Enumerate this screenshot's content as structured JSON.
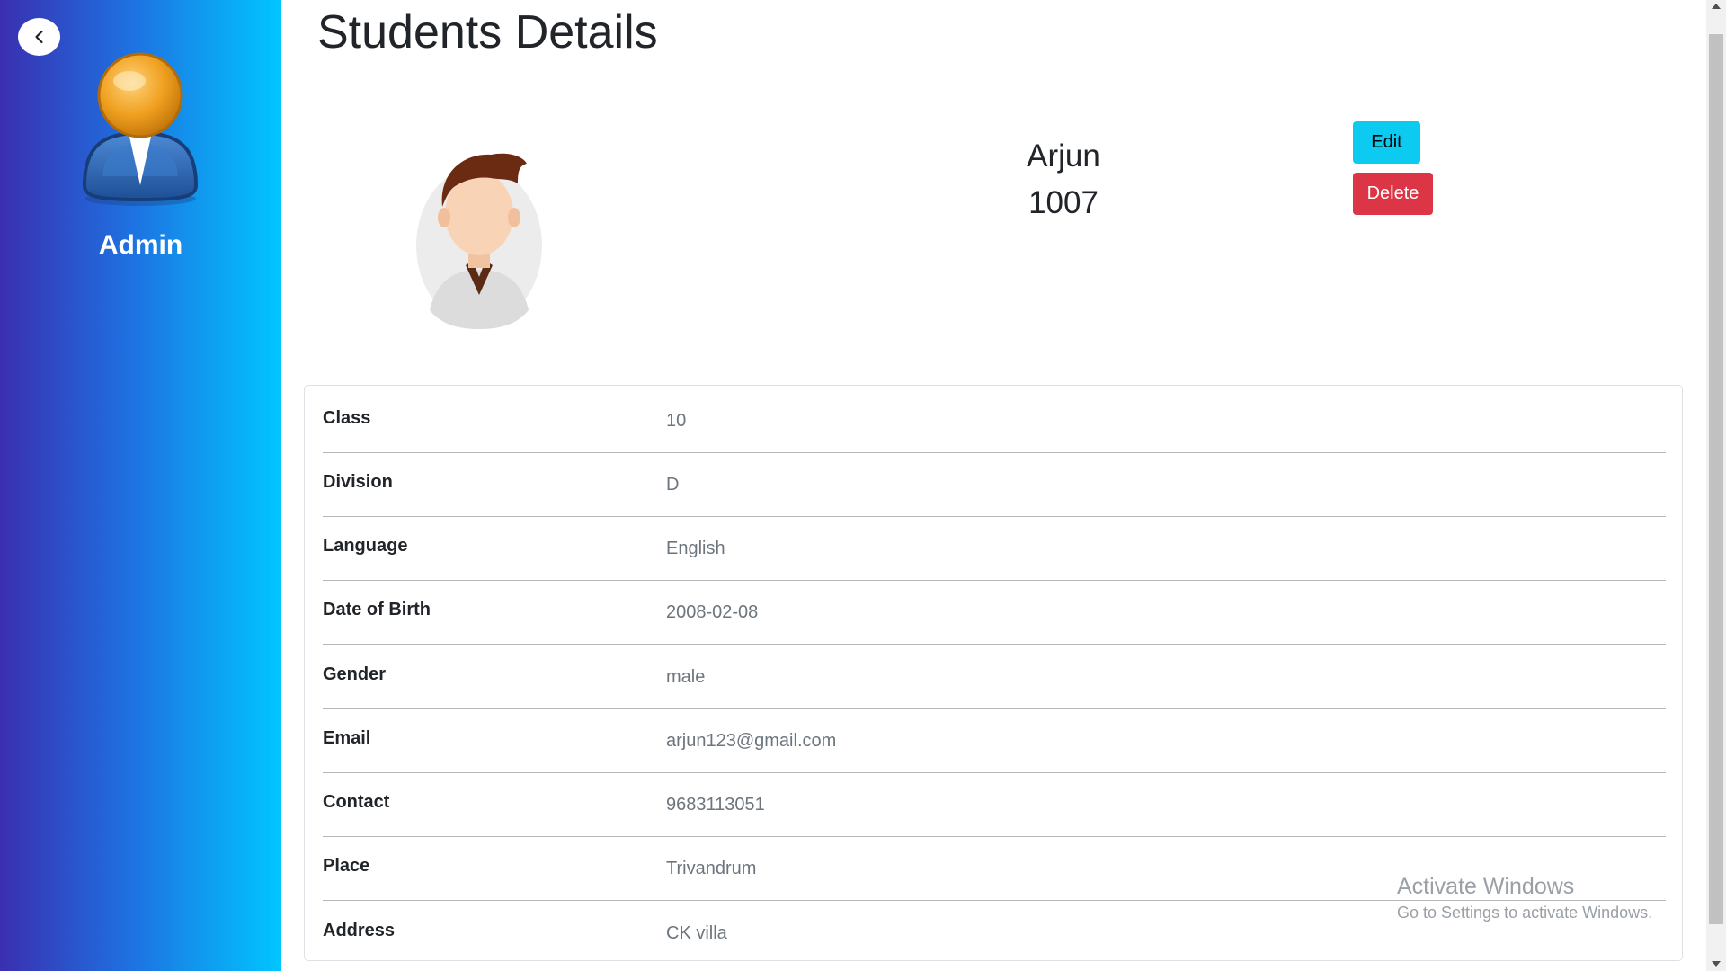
{
  "sidebar": {
    "user_label": "Admin",
    "gradient_colors": [
      "#3a2fb0",
      "#1f6fe0",
      "#00c6ff"
    ]
  },
  "page": {
    "title": "Students Details"
  },
  "student": {
    "name": "Arjun",
    "id": "1007"
  },
  "actions": {
    "edit_label": "Edit",
    "delete_label": "Delete",
    "edit_color": "#0dcaf0",
    "delete_color": "#dc3545"
  },
  "details": [
    {
      "label": "Class",
      "value": "10"
    },
    {
      "label": "Division",
      "value": "D"
    },
    {
      "label": "Language",
      "value": "English"
    },
    {
      "label": "Date of Birth",
      "value": "2008-02-08"
    },
    {
      "label": "Gender",
      "value": "male"
    },
    {
      "label": "Email",
      "value": "arjun123@gmail.com"
    },
    {
      "label": "Contact",
      "value": "9683113051"
    },
    {
      "label": "Place",
      "value": "Trivandrum"
    },
    {
      "label": "Address",
      "value": "CK villa"
    }
  ],
  "watermark": {
    "title": "Activate Windows",
    "subtitle": "Go to Settings to activate Windows."
  }
}
